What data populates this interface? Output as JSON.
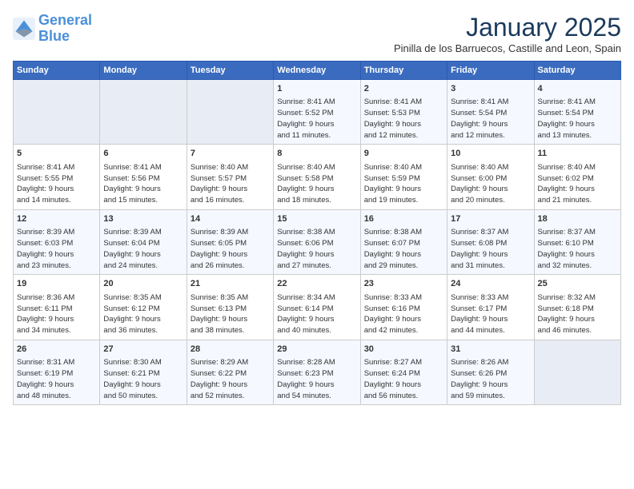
{
  "logo": {
    "line1": "General",
    "line2": "Blue"
  },
  "title": "January 2025",
  "subtitle": "Pinilla de los Barruecos, Castille and Leon, Spain",
  "days_of_week": [
    "Sunday",
    "Monday",
    "Tuesday",
    "Wednesday",
    "Thursday",
    "Friday",
    "Saturday"
  ],
  "weeks": [
    [
      {
        "day": "",
        "detail": ""
      },
      {
        "day": "",
        "detail": ""
      },
      {
        "day": "",
        "detail": ""
      },
      {
        "day": "1",
        "detail": "Sunrise: 8:41 AM\nSunset: 5:52 PM\nDaylight: 9 hours\nand 11 minutes."
      },
      {
        "day": "2",
        "detail": "Sunrise: 8:41 AM\nSunset: 5:53 PM\nDaylight: 9 hours\nand 12 minutes."
      },
      {
        "day": "3",
        "detail": "Sunrise: 8:41 AM\nSunset: 5:54 PM\nDaylight: 9 hours\nand 12 minutes."
      },
      {
        "day": "4",
        "detail": "Sunrise: 8:41 AM\nSunset: 5:54 PM\nDaylight: 9 hours\nand 13 minutes."
      }
    ],
    [
      {
        "day": "5",
        "detail": "Sunrise: 8:41 AM\nSunset: 5:55 PM\nDaylight: 9 hours\nand 14 minutes."
      },
      {
        "day": "6",
        "detail": "Sunrise: 8:41 AM\nSunset: 5:56 PM\nDaylight: 9 hours\nand 15 minutes."
      },
      {
        "day": "7",
        "detail": "Sunrise: 8:40 AM\nSunset: 5:57 PM\nDaylight: 9 hours\nand 16 minutes."
      },
      {
        "day": "8",
        "detail": "Sunrise: 8:40 AM\nSunset: 5:58 PM\nDaylight: 9 hours\nand 18 minutes."
      },
      {
        "day": "9",
        "detail": "Sunrise: 8:40 AM\nSunset: 5:59 PM\nDaylight: 9 hours\nand 19 minutes."
      },
      {
        "day": "10",
        "detail": "Sunrise: 8:40 AM\nSunset: 6:00 PM\nDaylight: 9 hours\nand 20 minutes."
      },
      {
        "day": "11",
        "detail": "Sunrise: 8:40 AM\nSunset: 6:02 PM\nDaylight: 9 hours\nand 21 minutes."
      }
    ],
    [
      {
        "day": "12",
        "detail": "Sunrise: 8:39 AM\nSunset: 6:03 PM\nDaylight: 9 hours\nand 23 minutes."
      },
      {
        "day": "13",
        "detail": "Sunrise: 8:39 AM\nSunset: 6:04 PM\nDaylight: 9 hours\nand 24 minutes."
      },
      {
        "day": "14",
        "detail": "Sunrise: 8:39 AM\nSunset: 6:05 PM\nDaylight: 9 hours\nand 26 minutes."
      },
      {
        "day": "15",
        "detail": "Sunrise: 8:38 AM\nSunset: 6:06 PM\nDaylight: 9 hours\nand 27 minutes."
      },
      {
        "day": "16",
        "detail": "Sunrise: 8:38 AM\nSunset: 6:07 PM\nDaylight: 9 hours\nand 29 minutes."
      },
      {
        "day": "17",
        "detail": "Sunrise: 8:37 AM\nSunset: 6:08 PM\nDaylight: 9 hours\nand 31 minutes."
      },
      {
        "day": "18",
        "detail": "Sunrise: 8:37 AM\nSunset: 6:10 PM\nDaylight: 9 hours\nand 32 minutes."
      }
    ],
    [
      {
        "day": "19",
        "detail": "Sunrise: 8:36 AM\nSunset: 6:11 PM\nDaylight: 9 hours\nand 34 minutes."
      },
      {
        "day": "20",
        "detail": "Sunrise: 8:35 AM\nSunset: 6:12 PM\nDaylight: 9 hours\nand 36 minutes."
      },
      {
        "day": "21",
        "detail": "Sunrise: 8:35 AM\nSunset: 6:13 PM\nDaylight: 9 hours\nand 38 minutes."
      },
      {
        "day": "22",
        "detail": "Sunrise: 8:34 AM\nSunset: 6:14 PM\nDaylight: 9 hours\nand 40 minutes."
      },
      {
        "day": "23",
        "detail": "Sunrise: 8:33 AM\nSunset: 6:16 PM\nDaylight: 9 hours\nand 42 minutes."
      },
      {
        "day": "24",
        "detail": "Sunrise: 8:33 AM\nSunset: 6:17 PM\nDaylight: 9 hours\nand 44 minutes."
      },
      {
        "day": "25",
        "detail": "Sunrise: 8:32 AM\nSunset: 6:18 PM\nDaylight: 9 hours\nand 46 minutes."
      }
    ],
    [
      {
        "day": "26",
        "detail": "Sunrise: 8:31 AM\nSunset: 6:19 PM\nDaylight: 9 hours\nand 48 minutes."
      },
      {
        "day": "27",
        "detail": "Sunrise: 8:30 AM\nSunset: 6:21 PM\nDaylight: 9 hours\nand 50 minutes."
      },
      {
        "day": "28",
        "detail": "Sunrise: 8:29 AM\nSunset: 6:22 PM\nDaylight: 9 hours\nand 52 minutes."
      },
      {
        "day": "29",
        "detail": "Sunrise: 8:28 AM\nSunset: 6:23 PM\nDaylight: 9 hours\nand 54 minutes."
      },
      {
        "day": "30",
        "detail": "Sunrise: 8:27 AM\nSunset: 6:24 PM\nDaylight: 9 hours\nand 56 minutes."
      },
      {
        "day": "31",
        "detail": "Sunrise: 8:26 AM\nSunset: 6:26 PM\nDaylight: 9 hours\nand 59 minutes."
      },
      {
        "day": "",
        "detail": ""
      }
    ]
  ]
}
